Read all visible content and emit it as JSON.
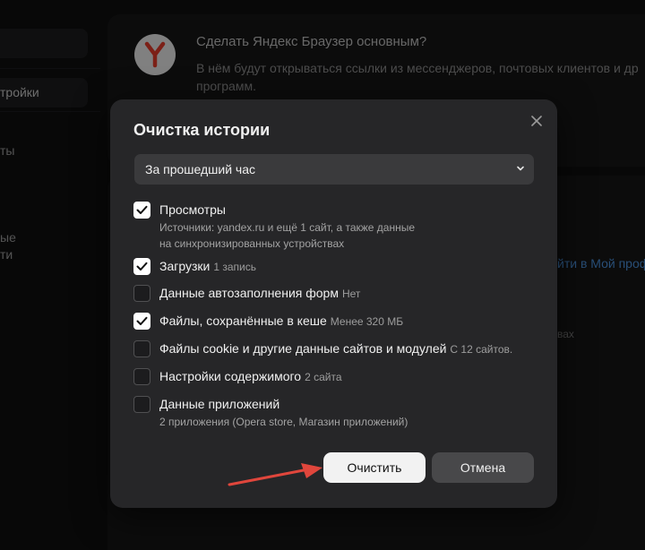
{
  "background": {
    "sidebar": {
      "items": [
        "тройки",
        "ты",
        "ые",
        "ти"
      ]
    },
    "promo": {
      "title": "Сделать Яндекс Браузер основным?",
      "desc_line1": "В нём будут открываться ссылки из мессенджеров, почтовых клиентов и др",
      "desc_line2": "программ."
    },
    "link_text": "йти в Мой проф",
    "snippet_text": "вах"
  },
  "dialog": {
    "title": "Очистка истории",
    "period": {
      "selected": "За прошедший час"
    },
    "options": [
      {
        "label": "Просмотры",
        "hint": "",
        "checked": true,
        "sub1": "Источники: yandex.ru и ещё 1 сайт, а также данные",
        "sub2": "на синхронизированных устройствах"
      },
      {
        "label": "Загрузки",
        "hint": "1 запись",
        "checked": true
      },
      {
        "label": "Данные автозаполнения форм",
        "hint": "Нет",
        "checked": false
      },
      {
        "label": "Файлы, сохранённые в кеше",
        "hint": "Менее 320 МБ",
        "checked": true
      },
      {
        "label": "Файлы cookie и другие данные сайтов и модулей",
        "hint": "С 12 сайтов.",
        "checked": false
      },
      {
        "label": "Настройки содержимого",
        "hint": "2 сайта",
        "checked": false
      },
      {
        "label": "Данные приложений",
        "hint": "",
        "checked": false,
        "sub1": "2 приложения (Opera store, Магазин приложений)"
      }
    ],
    "clear_label": "Очистить",
    "cancel_label": "Отмена"
  },
  "colors": {
    "accent_arrow": "#e0463c",
    "dialog_bg": "#262628",
    "primary_button": "#f2f2f2"
  }
}
